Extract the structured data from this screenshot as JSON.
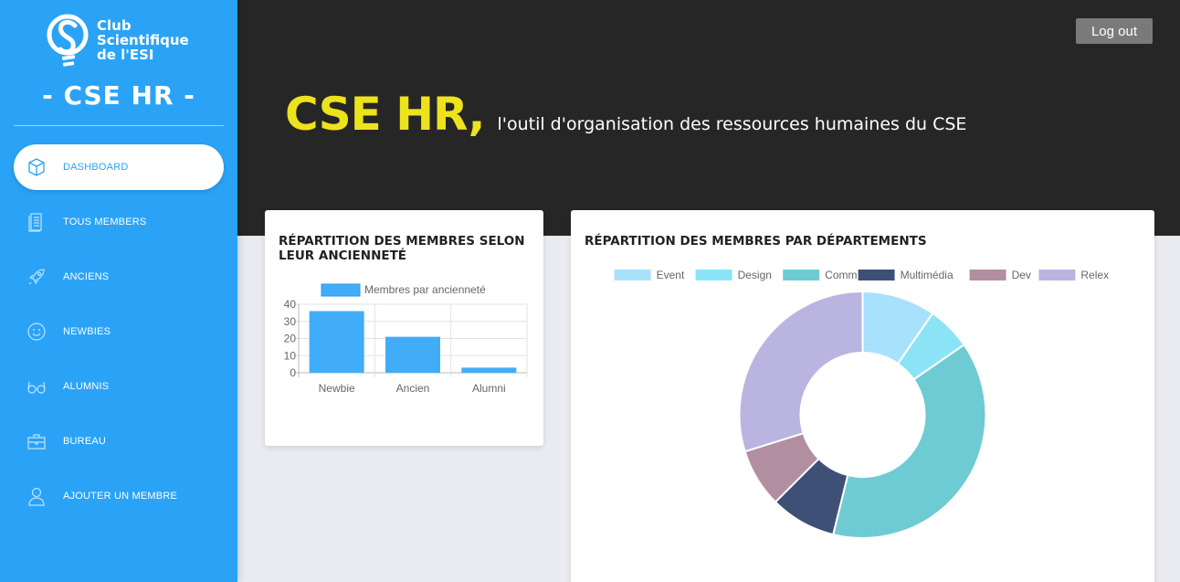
{
  "sidebar": {
    "logo_text": "Club\nScientifique\nde l'ESI",
    "brand": "- CSE HR -",
    "items": [
      {
        "label": "DASHBOARD",
        "icon": "box-icon",
        "active": true
      },
      {
        "label": "TOUS MEMBERS",
        "icon": "document-list-icon",
        "active": false
      },
      {
        "label": "ANCIENS",
        "icon": "rocket-icon",
        "active": false
      },
      {
        "label": "NEWBIES",
        "icon": "smiley-icon",
        "active": false
      },
      {
        "label": "ALUMNIS",
        "icon": "glasses-icon",
        "active": false
      },
      {
        "label": "BUREAU",
        "icon": "briefcase-icon",
        "active": false
      },
      {
        "label": "AJOUTER UN MEMBRE",
        "icon": "user-icon",
        "active": false
      }
    ]
  },
  "header": {
    "logout_label": "Log out",
    "title": "CSE HR,",
    "subtitle": "l'outil d'organisation des ressources humaines du CSE"
  },
  "cards": {
    "seniority_title": "RÉPARTITION DES MEMBRES SELON LEUR ANCIENNETÉ",
    "departments_title": "RÉPARTITION DES MEMBRES PAR DÉPARTEMENTS"
  },
  "colors": {
    "sidebar": "#2aa3f7",
    "header": "#262626",
    "accent_yellow": "#ede31c",
    "bar": "#41adf8"
  },
  "chart_data": [
    {
      "type": "bar",
      "categories": [
        "Newbie",
        "Ancien",
        "Alumni"
      ],
      "series": [
        {
          "name": "Membres par ancienneté",
          "values": [
            36,
            21,
            3
          ]
        }
      ],
      "ylim": [
        0,
        40
      ],
      "yticks": [
        0,
        10,
        20,
        30,
        40
      ],
      "grid": true,
      "legend": "top"
    },
    {
      "type": "pie",
      "donut": true,
      "labels": [
        "Event",
        "Design",
        "Comm",
        "Multimédia",
        "Dev",
        "Relex"
      ],
      "values": [
        10,
        6,
        40,
        9,
        8,
        31
      ],
      "colors": [
        "#a8e1fb",
        "#8be4f5",
        "#6fcbd3",
        "#3f5077",
        "#b28fa0",
        "#b9b5e0"
      ],
      "legend": "top"
    }
  ]
}
